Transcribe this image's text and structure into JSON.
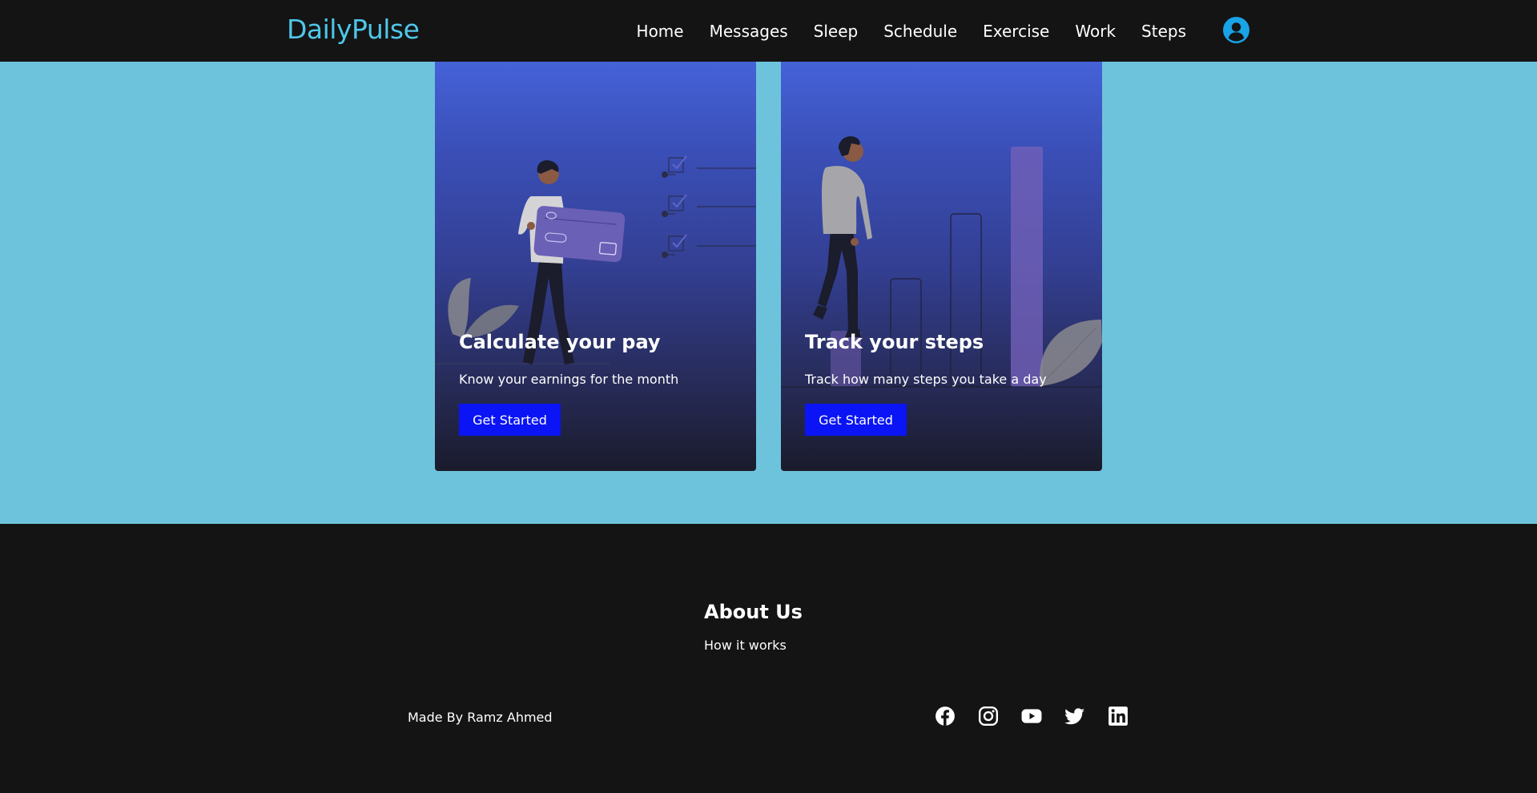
{
  "header": {
    "logo": "DailyPulse",
    "nav": [
      "Home",
      "Messages",
      "Sleep",
      "Schedule",
      "Exercise",
      "Work",
      "Steps"
    ],
    "avatar_icon": "user-circle-icon"
  },
  "cards": [
    {
      "title": "Calculate your pay",
      "subtitle": "Know your earnings for the month",
      "button": "Get Started"
    },
    {
      "title": "Track your steps",
      "subtitle": "Track how many steps you take a day",
      "button": "Get Started"
    }
  ],
  "footer": {
    "about_title": "About Us",
    "about_link": "How it works",
    "made_by": "Made By Ramz Ahmed",
    "socials": [
      "facebook-icon",
      "instagram-icon",
      "youtube-icon",
      "twitter-icon",
      "linkedin-icon"
    ]
  },
  "colors": {
    "nav_bg": "#141414",
    "logo": "#4fc6ea",
    "page_bg": "#6ec3dc",
    "button": "#0a14f5",
    "avatar": "#1aa3e6"
  }
}
